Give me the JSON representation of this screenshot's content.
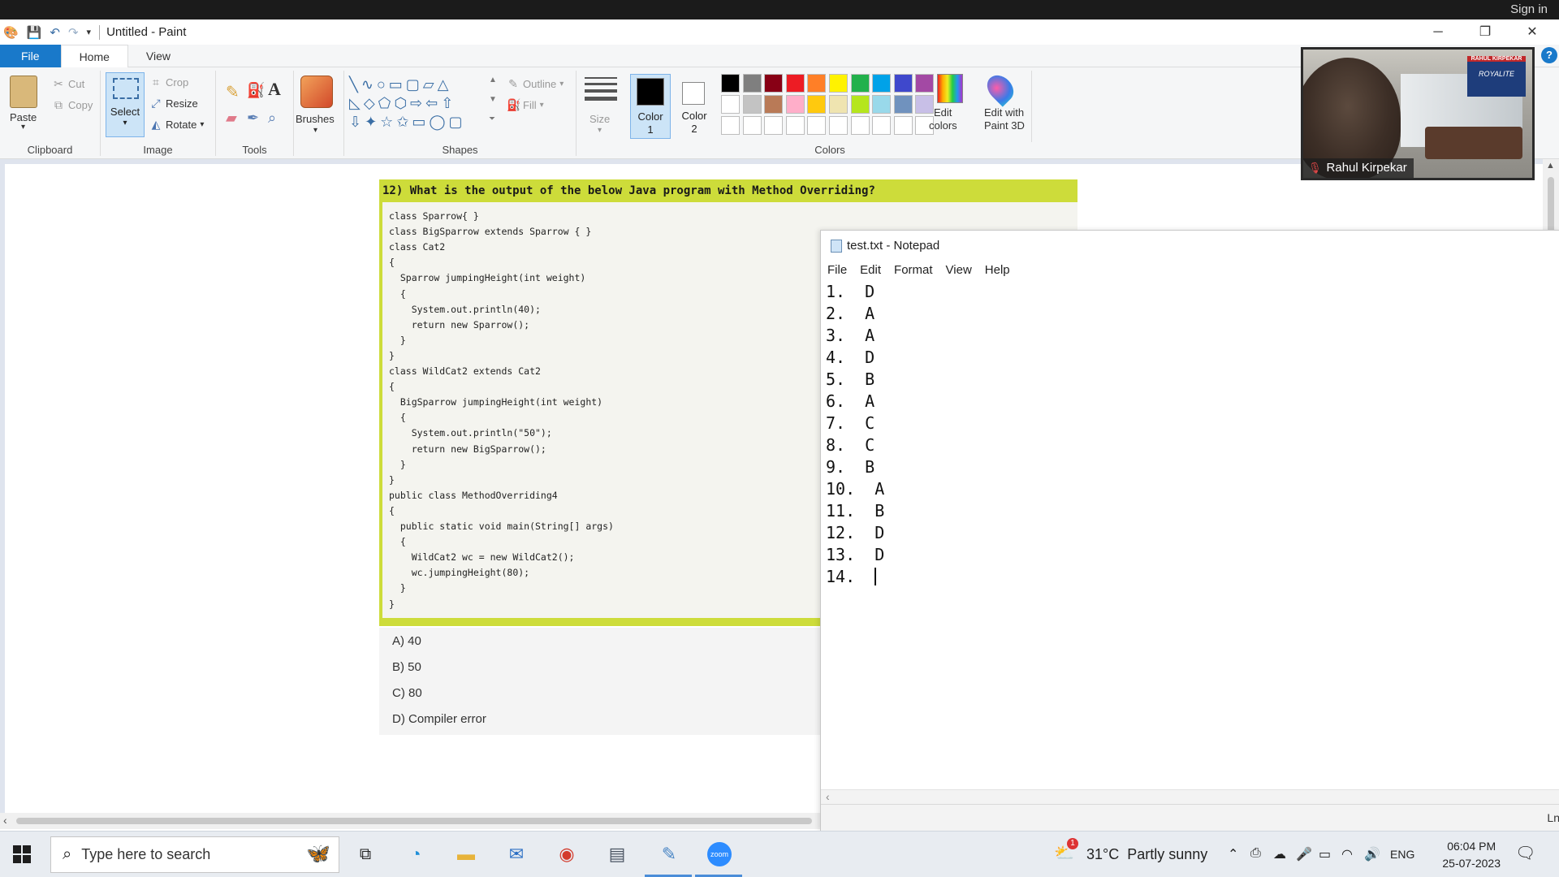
{
  "window": {
    "title": "Untitled - Paint",
    "signin": "Sign in"
  },
  "tabs": [
    "File",
    "Home",
    "View"
  ],
  "ribbon": {
    "clipboard": {
      "paste": "Paste",
      "cut": "Cut",
      "copy": "Copy",
      "label": "Clipboard"
    },
    "image": {
      "select": "Select",
      "crop": "Crop",
      "resize": "Resize",
      "rotate": "Rotate",
      "label": "Image"
    },
    "tools": {
      "label": "Tools"
    },
    "brushes": {
      "label": "Brushes"
    },
    "shapes": {
      "outline": "Outline",
      "fill": "Fill",
      "label": "Shapes"
    },
    "size": {
      "label": "Size"
    },
    "colors": {
      "color1": "Color",
      "color1_num": "1",
      "color2": "Color",
      "color2_num": "2",
      "edit_colors_line1": "Edit",
      "edit_colors_line2": "colors",
      "paint3d_line1": "Edit with",
      "paint3d_line2": "Paint 3D",
      "label": "Colors",
      "palette_row1": [
        "#000000",
        "#7f7f7f",
        "#880015",
        "#ed1c24",
        "#ff7f27",
        "#fff200",
        "#22b14c",
        "#00a2e8",
        "#3f48cc",
        "#a349a4"
      ],
      "palette_row2": [
        "#ffffff",
        "#c3c3c3",
        "#b97a57",
        "#ffaec9",
        "#ffc90e",
        "#efe4b0",
        "#b5e61d",
        "#99d9ea",
        "#7092be",
        "#c8bfe7"
      ],
      "palette_row3": [
        "#ffffff",
        "#ffffff",
        "#ffffff",
        "#ffffff",
        "#ffffff",
        "#ffffff",
        "#ffffff",
        "#ffffff",
        "#ffffff",
        "#ffffff"
      ]
    }
  },
  "question": {
    "header": "12) What is the output of the below Java program with Method Overriding?",
    "code": [
      "class Sparrow{ }",
      "class BigSparrow extends Sparrow { }",
      "class Cat2",
      "{",
      "  Sparrow jumpingHeight(int weight)",
      "  {",
      "    System.out.println(40);",
      "    return new Sparrow();",
      "  }",
      "}",
      "class WildCat2 extends Cat2",
      "{",
      "  BigSparrow jumpingHeight(int weight)",
      "  {",
      "    System.out.println(\"50\");",
      "    return new BigSparrow();",
      "  }",
      "}",
      "public class MethodOverriding4",
      "{",
      "  public static void main(String[] args)",
      "  {",
      "    WildCat2 wc = new WildCat2();",
      "    wc.jumpingHeight(80);",
      "  }",
      "}"
    ],
    "options": [
      "A) 40",
      "B) 50",
      "C) 80",
      "D) Compiler error"
    ]
  },
  "video": {
    "name": "Rahul Kirpekar",
    "badge_top": "RAHUL KIRPEKAR",
    "badge_brand": "ROYALITE"
  },
  "notepad": {
    "title": "test.txt - Notepad",
    "menu": [
      "File",
      "Edit",
      "Format",
      "View",
      "Help"
    ],
    "lines": [
      "1.  D",
      "2.  A",
      "3.  A",
      "4.  D",
      "5.  B",
      "6.  A",
      "7.  C",
      "8.  C",
      "9.  B",
      "10.  A",
      "11.  B",
      "12.  D",
      "13.  D",
      "14.  "
    ],
    "status": "Ln"
  },
  "taskbar": {
    "search_placeholder": "Type here to search",
    "weather": "31°C  Partly sunny",
    "weather_badge": "1",
    "lang": "ENG",
    "time": "06:04 PM",
    "date": "25-07-2023"
  }
}
